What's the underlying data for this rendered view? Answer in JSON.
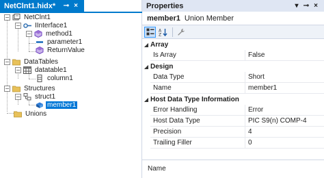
{
  "left_tab": {
    "title": "NetClnt1.hidx*",
    "pin": "⊸",
    "close": "×"
  },
  "right_tab": {
    "title": "Properties",
    "dropdown": "▾",
    "pin": "⊸",
    "close": "×"
  },
  "tree": {
    "root": "NetClnt1",
    "interface": "IInterface1",
    "method": "method1",
    "param": "parameter1",
    "retval": "ReturnValue",
    "datatables": "DataTables",
    "datatable": "datatable1",
    "column": "column1",
    "structures": "Structures",
    "struct": "struct1",
    "member": "member1",
    "unions": "Unions"
  },
  "object": {
    "name": "member1",
    "type": "Union Member"
  },
  "toolbar": {
    "categorized_icon": "categorized-icon",
    "alpha_icon": "alphabetical-icon",
    "pages_icon": "wrench-icon"
  },
  "categories": {
    "array": "Array",
    "design": "Design",
    "host": "Host Data Type Information"
  },
  "props": {
    "is_array": {
      "name": "Is Array",
      "value": "False"
    },
    "data_type": {
      "name": "Data Type",
      "value": "Short"
    },
    "name": {
      "name": "Name",
      "value": "member1"
    },
    "error_handling": {
      "name": "Error Handling",
      "value": "Error"
    },
    "host_data_type": {
      "name": "Host Data Type",
      "value": "PIC S9(n) COMP-4"
    },
    "precision": {
      "name": "Precision",
      "value": "4"
    },
    "trailing_filler": {
      "name": "Trailing Filler",
      "value": "0"
    }
  },
  "description": {
    "title": "Name"
  },
  "colors": {
    "accent": "#007acc",
    "selection": "#0078d7",
    "tab_inactive": "#dfe6f3"
  }
}
